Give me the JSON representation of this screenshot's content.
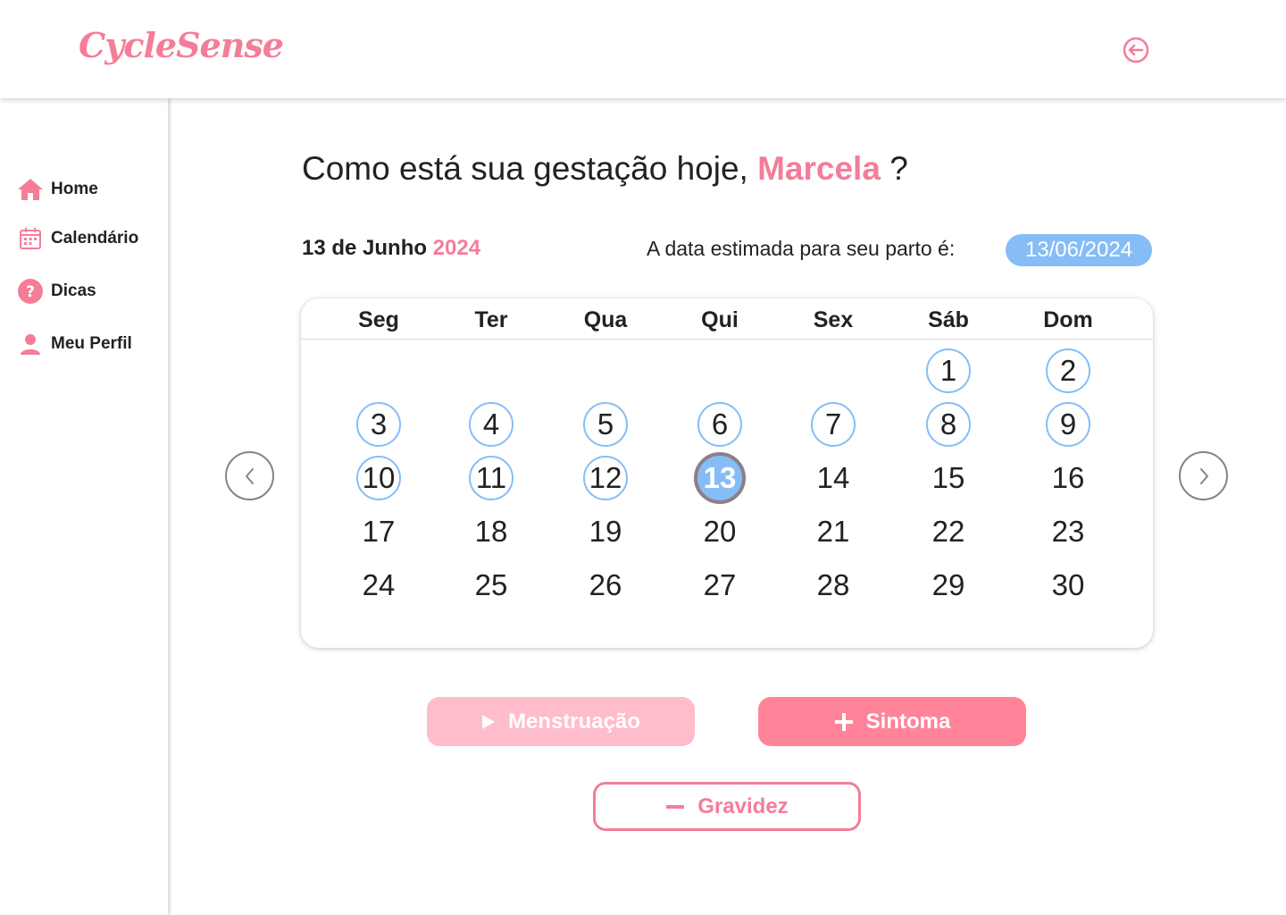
{
  "app": {
    "logo": "CycleSense"
  },
  "header": {
    "logout_icon": "logout-arrow-icon"
  },
  "sidebar": {
    "items": [
      {
        "label": "Home",
        "icon": "home-icon"
      },
      {
        "label": "Calendário",
        "icon": "calendar-icon"
      },
      {
        "label": "Dicas",
        "icon": "question-icon"
      },
      {
        "label": "Meu Perfil",
        "icon": "user-icon"
      }
    ]
  },
  "greeting": {
    "prefix": "Como está sua gestação hoje,",
    "name": "Marcela",
    "suffix": "?"
  },
  "current_date": {
    "day_month": "13 de Junho",
    "year": "2024"
  },
  "due_date": {
    "label": "A data estimada para seu parto é:",
    "value": "13/06/2024"
  },
  "calendar": {
    "weekdays": [
      "Seg",
      "Ter",
      "Qua",
      "Qui",
      "Sex",
      "Sáb",
      "Dom"
    ],
    "weeks": [
      [
        null,
        null,
        null,
        null,
        null,
        "1",
        "2"
      ],
      [
        "3",
        "4",
        "5",
        "6",
        "7",
        "8",
        "9"
      ],
      [
        "10",
        "11",
        "12",
        "13",
        "14",
        "15",
        "16"
      ],
      [
        "17",
        "18",
        "19",
        "20",
        "21",
        "22",
        "23"
      ],
      [
        "24",
        "25",
        "26",
        "27",
        "28",
        "29",
        "30"
      ]
    ],
    "marked_days": [
      "1",
      "2",
      "3",
      "4",
      "5",
      "6",
      "7",
      "8",
      "9",
      "10",
      "11",
      "12"
    ],
    "today": "13",
    "prev_icon": "chevron-left-icon",
    "next_icon": "chevron-right-icon"
  },
  "actions": {
    "menstruacao": "Menstruação",
    "sintoma": "Sintoma",
    "gravidez": "Gravidez"
  },
  "colors": {
    "brand_pink": "#f47d98",
    "accent_blue": "#86bdf7",
    "button_pink": "#ff8399",
    "button_pink_light": "#ffbccb"
  }
}
